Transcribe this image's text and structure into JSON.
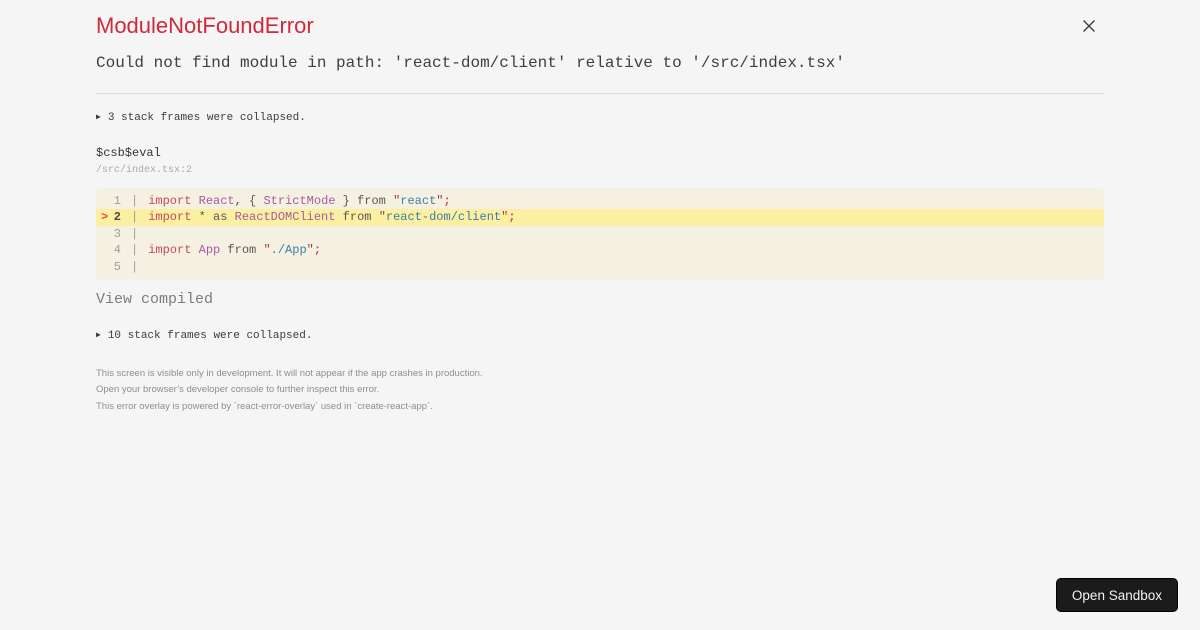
{
  "colors": {
    "page_bg": "#f5f5f5",
    "title_red": "#ce2a39",
    "text_dark": "#3f3f3f",
    "divider": "#dcdcdc",
    "location_gray": "#ababab",
    "code_bg": "#f5f1e2",
    "code_highlight_bg": "#fbf0a2",
    "token_keyword_red": "#c9485b",
    "token_identifier_purple": "#a65ba0",
    "token_plain_gray": "#575757",
    "token_string_blue": "#3c7da6",
    "token_quote_darkred": "#a03d48",
    "active_line_marker_red": "#dc5140",
    "line_number_gray": "#9e9e9e",
    "view_compiled_gray": "#7d7d7d",
    "footer_gray": "#8a8f92",
    "button_bg": "#1b1b1b",
    "button_text": "#f2f2f2"
  },
  "icons": {
    "triangle": "▶",
    "close": "×"
  },
  "header": {
    "title": "ModuleNotFoundError",
    "message": "Could not find module in path: 'react-dom/client' relative to '/src/index.tsx'"
  },
  "stack_top": {
    "collapsed_text": "3 stack frames were collapsed."
  },
  "frame": {
    "name": "$csb$eval",
    "location": "/src/index.tsx:2",
    "view_compiled_label": "View compiled"
  },
  "code": {
    "lines": [
      {
        "num": "1",
        "active": false,
        "marker": "",
        "tokens": [
          [
            "kw",
            "import"
          ],
          [
            "pl",
            " "
          ],
          [
            "id",
            "React"
          ],
          [
            "pl",
            ", { "
          ],
          [
            "id",
            "StrictMode"
          ],
          [
            "pl",
            " } from "
          ],
          [
            "qt",
            "\""
          ],
          [
            "st",
            "react"
          ],
          [
            "qt",
            "\""
          ],
          [
            "sc",
            ";"
          ]
        ]
      },
      {
        "num": "2",
        "active": true,
        "marker": ">",
        "tokens": [
          [
            "kw",
            "import"
          ],
          [
            "pl",
            " * as "
          ],
          [
            "id",
            "ReactDOMClient"
          ],
          [
            "pl",
            " from "
          ],
          [
            "qt",
            "\""
          ],
          [
            "st",
            "react-dom/client"
          ],
          [
            "qt",
            "\""
          ],
          [
            "sc",
            ";"
          ]
        ]
      },
      {
        "num": "3",
        "active": false,
        "marker": "",
        "tokens": []
      },
      {
        "num": "4",
        "active": false,
        "marker": "",
        "tokens": [
          [
            "kw",
            "import"
          ],
          [
            "pl",
            " "
          ],
          [
            "id",
            "App"
          ],
          [
            "pl",
            " from "
          ],
          [
            "qt",
            "\""
          ],
          [
            "st",
            "./App"
          ],
          [
            "qt",
            "\""
          ],
          [
            "sc",
            ";"
          ]
        ]
      },
      {
        "num": "5",
        "active": false,
        "marker": "",
        "tokens": []
      }
    ]
  },
  "stack_bottom": {
    "collapsed_text": "10 stack frames were collapsed."
  },
  "footer": {
    "lines": [
      "This screen is visible only in development. It will not appear if the app crashes in production.",
      "Open your browser’s developer console to further inspect this error.",
      "This error overlay is powered by `react-error-overlay` used in `create-react-app`."
    ]
  },
  "sandbox_button": {
    "label": "Open Sandbox"
  }
}
